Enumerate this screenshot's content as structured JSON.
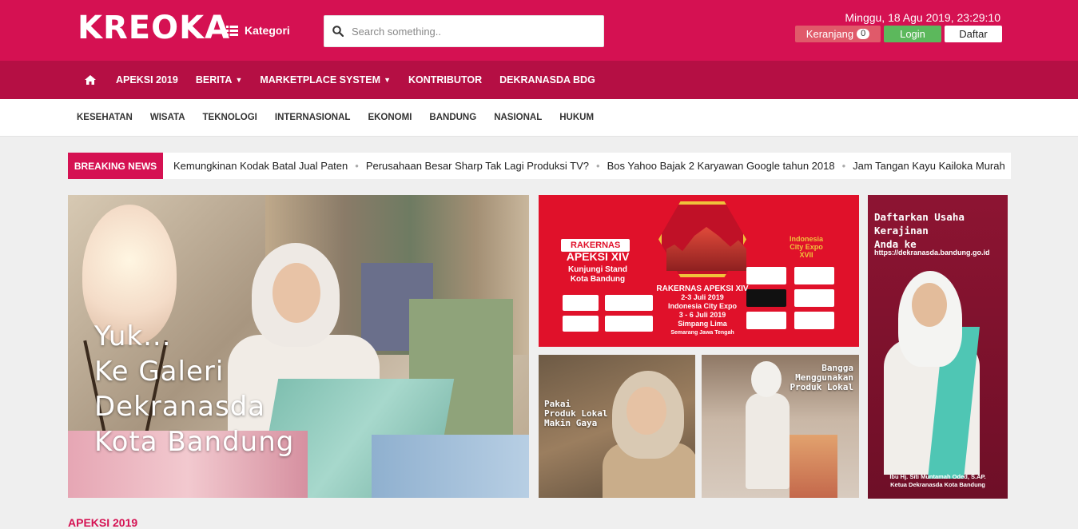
{
  "header": {
    "logo": "KREOKA",
    "kategori_label": "Kategori",
    "search_placeholder": "Search something..",
    "datetime": "Minggu, 18 Agu 2019, 23:29:10",
    "cart_label": "Keranjang",
    "cart_count": "0",
    "login_label": "Login",
    "daftar_label": "Daftar",
    "brand_color": "#d51152"
  },
  "main_nav": {
    "home_icon": "home-icon",
    "items": [
      {
        "label": "APEKSI 2019",
        "dropdown": false
      },
      {
        "label": "BERITA",
        "dropdown": true
      },
      {
        "label": "MARKETPLACE SYSTEM",
        "dropdown": true
      },
      {
        "label": "KONTRIBUTOR",
        "dropdown": false
      },
      {
        "label": "DEKRANASDA BDG",
        "dropdown": false
      }
    ]
  },
  "sub_nav": {
    "items": [
      "KESEHATAN",
      "WISATA",
      "TEKNOLOGI",
      "INTERNASIONAL",
      "EKONOMI",
      "BANDUNG",
      "NASIONAL",
      "HUKUM"
    ]
  },
  "breaking_news": {
    "label": "BREAKING NEWS",
    "items": [
      "Kemungkinan Kodak Batal Jual Paten",
      "Perusahaan Besar Sharp Tak Lagi Produksi TV?",
      "Bos Yahoo Bajak 2 Karyawan Google tahun 2018",
      "Jam Tangan Kayu Kailoka Murah"
    ]
  },
  "featured": {
    "hero_lines": [
      "Yuk...",
      "Ke Galeri",
      "Dekranasda",
      "Kota Bandung"
    ],
    "apeksi": {
      "ribbon": "RAKERNAS",
      "title": "APEKSI XIV",
      "subtitle_lines": [
        "Kunjungi Stand",
        "Kota Bandung"
      ],
      "event_title": "RAKERNAS APEKSI XIV",
      "event_lines": [
        "2-3 Juli 2019",
        "Indonesia City Expo",
        "3 - 6 Juli 2019",
        "Simpang Lima",
        "Semarang Jawa Tengah"
      ],
      "expo_lines": [
        "Indonesia",
        "City Expo",
        "XVII"
      ]
    },
    "small1_lines": [
      "Pakai",
      "Produk Lokal",
      "Makin Gaya"
    ],
    "small2_lines": [
      "Bangga",
      "Menggunakan",
      "Produk Lokal"
    ],
    "daftar": {
      "headline_lines": [
        "Daftarkan Usaha",
        "Kerajinan",
        "Anda ke"
      ],
      "url": "https://dekranasda.bandung.go.id",
      "name_lines": [
        "Ibu Hj. Siti Muntamah Oded, S.AP.",
        "Ketua Dekranasda Kota Bandung"
      ]
    }
  },
  "section": {
    "title": "APEKSI 2019"
  }
}
